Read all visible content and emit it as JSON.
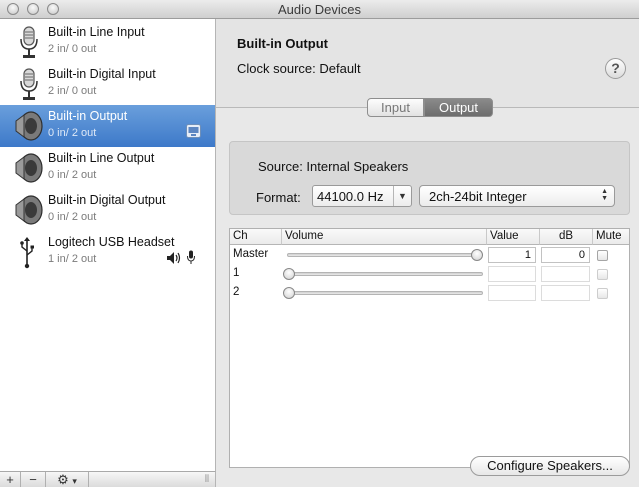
{
  "window": {
    "title": "Audio Devices"
  },
  "sidebar": {
    "devices": [
      {
        "name": "Built-in Line Input",
        "io": "2 in/ 0 out",
        "icon": "microphone-icon"
      },
      {
        "name": "Built-in Digital Input",
        "io": "2 in/ 0 out",
        "icon": "microphone-icon"
      },
      {
        "name": "Built-in Output",
        "io": "0 in/ 2 out",
        "icon": "speaker-icon",
        "selected": true
      },
      {
        "name": "Built-in Line Output",
        "io": "0 in/ 2 out",
        "icon": "speaker-icon"
      },
      {
        "name": "Built-in Digital Output",
        "io": "0 in/ 2 out",
        "icon": "speaker-icon"
      },
      {
        "name": "Logitech USB Headset",
        "io": "1 in/ 2 out",
        "icon": "usb-icon"
      }
    ],
    "buttons": {
      "add": "+",
      "remove": "−",
      "gear": "⚙",
      "menu": "▾",
      "resize": "⦀"
    }
  },
  "detail": {
    "device_name": "Built-in Output",
    "clock_source": "Clock source:  Default",
    "help": "?",
    "tabs": {
      "input": "Input",
      "output": "Output",
      "active": "Output"
    },
    "source": "Source:  Internal Speakers",
    "format_label": "Format:",
    "sample_rate": "44100.0 Hz",
    "bit_format": "2ch-24bit Integer",
    "table": {
      "headers": {
        "ch": "Ch",
        "volume": "Volume",
        "value": "Value",
        "db": "dB",
        "mute": "Mute"
      },
      "rows": [
        {
          "ch": "Master",
          "volume_level": 1.0,
          "value": "1",
          "db": "0",
          "muted": false,
          "enabled": true
        },
        {
          "ch": "1",
          "volume_level": 0.0,
          "value": "",
          "db": "",
          "muted": false,
          "enabled": false
        },
        {
          "ch": "2",
          "volume_level": 0.0,
          "value": "",
          "db": "",
          "muted": false,
          "enabled": false
        }
      ]
    },
    "configure_button": "Configure Speakers..."
  },
  "colors": {
    "selection": "#3d79c9",
    "segment_active": "#777777"
  }
}
